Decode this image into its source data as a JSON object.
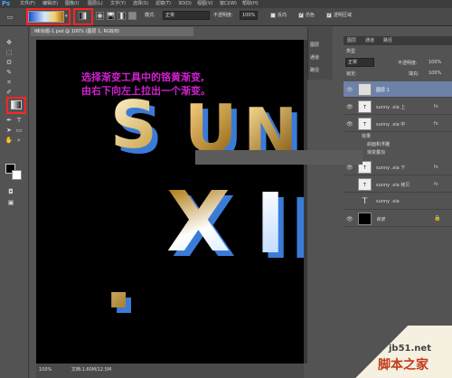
{
  "menubar": {
    "logo": "Ps",
    "items": [
      "文件(F)",
      "编辑(E)",
      "图像(I)",
      "图层(L)",
      "文字(Y)",
      "选择(S)",
      "滤镜(T)",
      "3D(D)",
      "视图(V)",
      "窗口(W)",
      "帮助(H)"
    ]
  },
  "options": {
    "mode_label": "模式:",
    "mode_value": "正常",
    "opacity_label": "不透明度:",
    "opacity_value": "100%",
    "reverse": "反向",
    "dither": "仿色",
    "transparency": "透明区域"
  },
  "document": {
    "tab_title": "未标题-1.psd @ 100% (图层 1, RGB/8)",
    "zoom": "100%",
    "doc_info": "文档:1.60M/12.5M"
  },
  "canvas": {
    "instruction_line1": "选择渐变工具中的铬黄渐变,",
    "instruction_line2": "由右下向左上拉出一个渐变。",
    "line1_letters": [
      "S",
      "U",
      "N",
      "N"
    ],
    "line2_letters": [
      ".",
      "X",
      "I",
      "I"
    ]
  },
  "minidock": {
    "items": [
      "图层",
      "通道",
      "路径"
    ]
  },
  "panel": {
    "tabs": [
      "图层",
      "通道",
      "路径"
    ],
    "kind_label": "类型",
    "blend_mode": "正常",
    "opacity_label": "不透明度:",
    "opacity_value": "100%",
    "fill_label": "填充:",
    "fill_value": "100%",
    "lock_label": "锁定:",
    "layers": [
      {
        "name": "图层 1",
        "fx": ""
      },
      {
        "name": "sunny .xia 上",
        "fx": "fx"
      },
      {
        "name": "sunny .xia 中",
        "fx": "fx"
      },
      {
        "name": "效果",
        "fx": ""
      },
      {
        "name": "斜面和浮雕",
        "fx": ""
      },
      {
        "name": "渐变叠加",
        "fx": ""
      },
      {
        "name": "sunny .xia 下",
        "fx": "fx"
      },
      {
        "name": "sunny .xia 拷贝",
        "fx": "fx"
      },
      {
        "name": "sunny .xia",
        "fx": ""
      },
      {
        "name": "背景",
        "fx": ""
      }
    ]
  },
  "watermark": {
    "url": "jb51.net",
    "name": "脚本之家"
  }
}
